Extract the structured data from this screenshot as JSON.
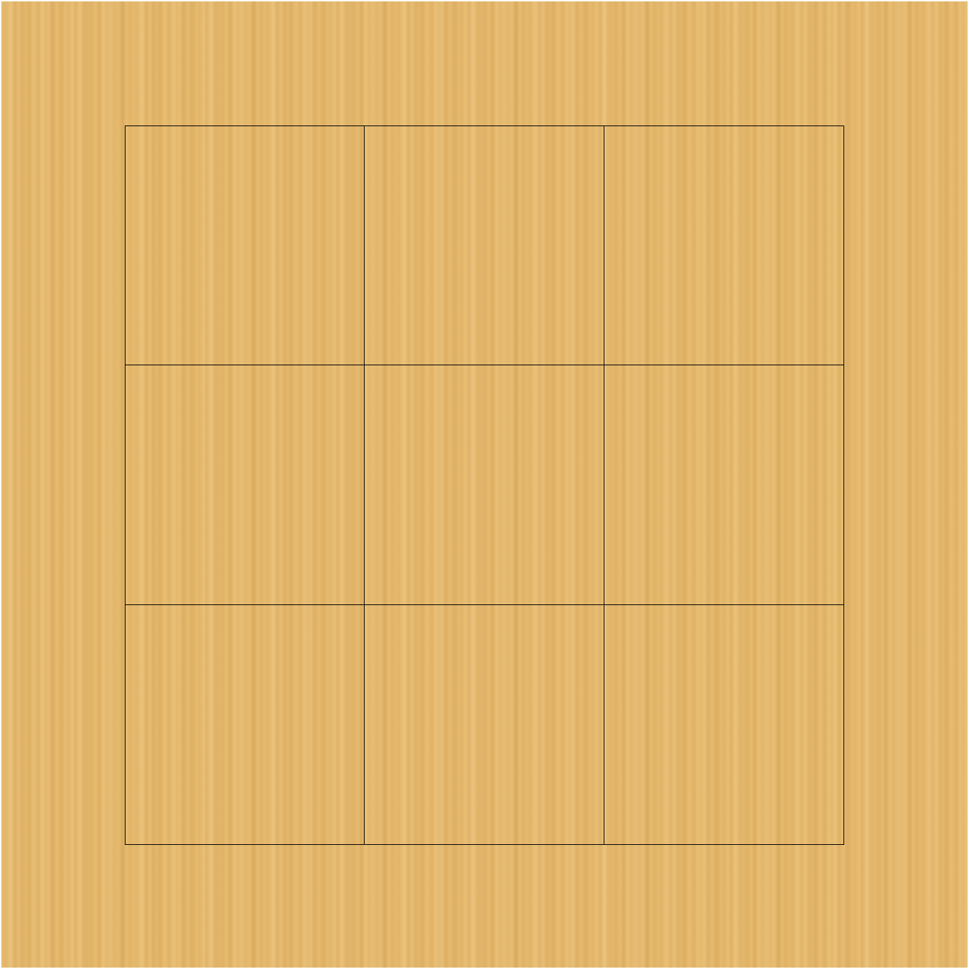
{
  "board": {
    "rows": 3,
    "cols": 3,
    "line_color": "#000000",
    "wood_color": "#e5b86b",
    "cells": [
      [
        "",
        "",
        ""
      ],
      [
        "",
        "",
        ""
      ],
      [
        "",
        "",
        ""
      ]
    ]
  }
}
